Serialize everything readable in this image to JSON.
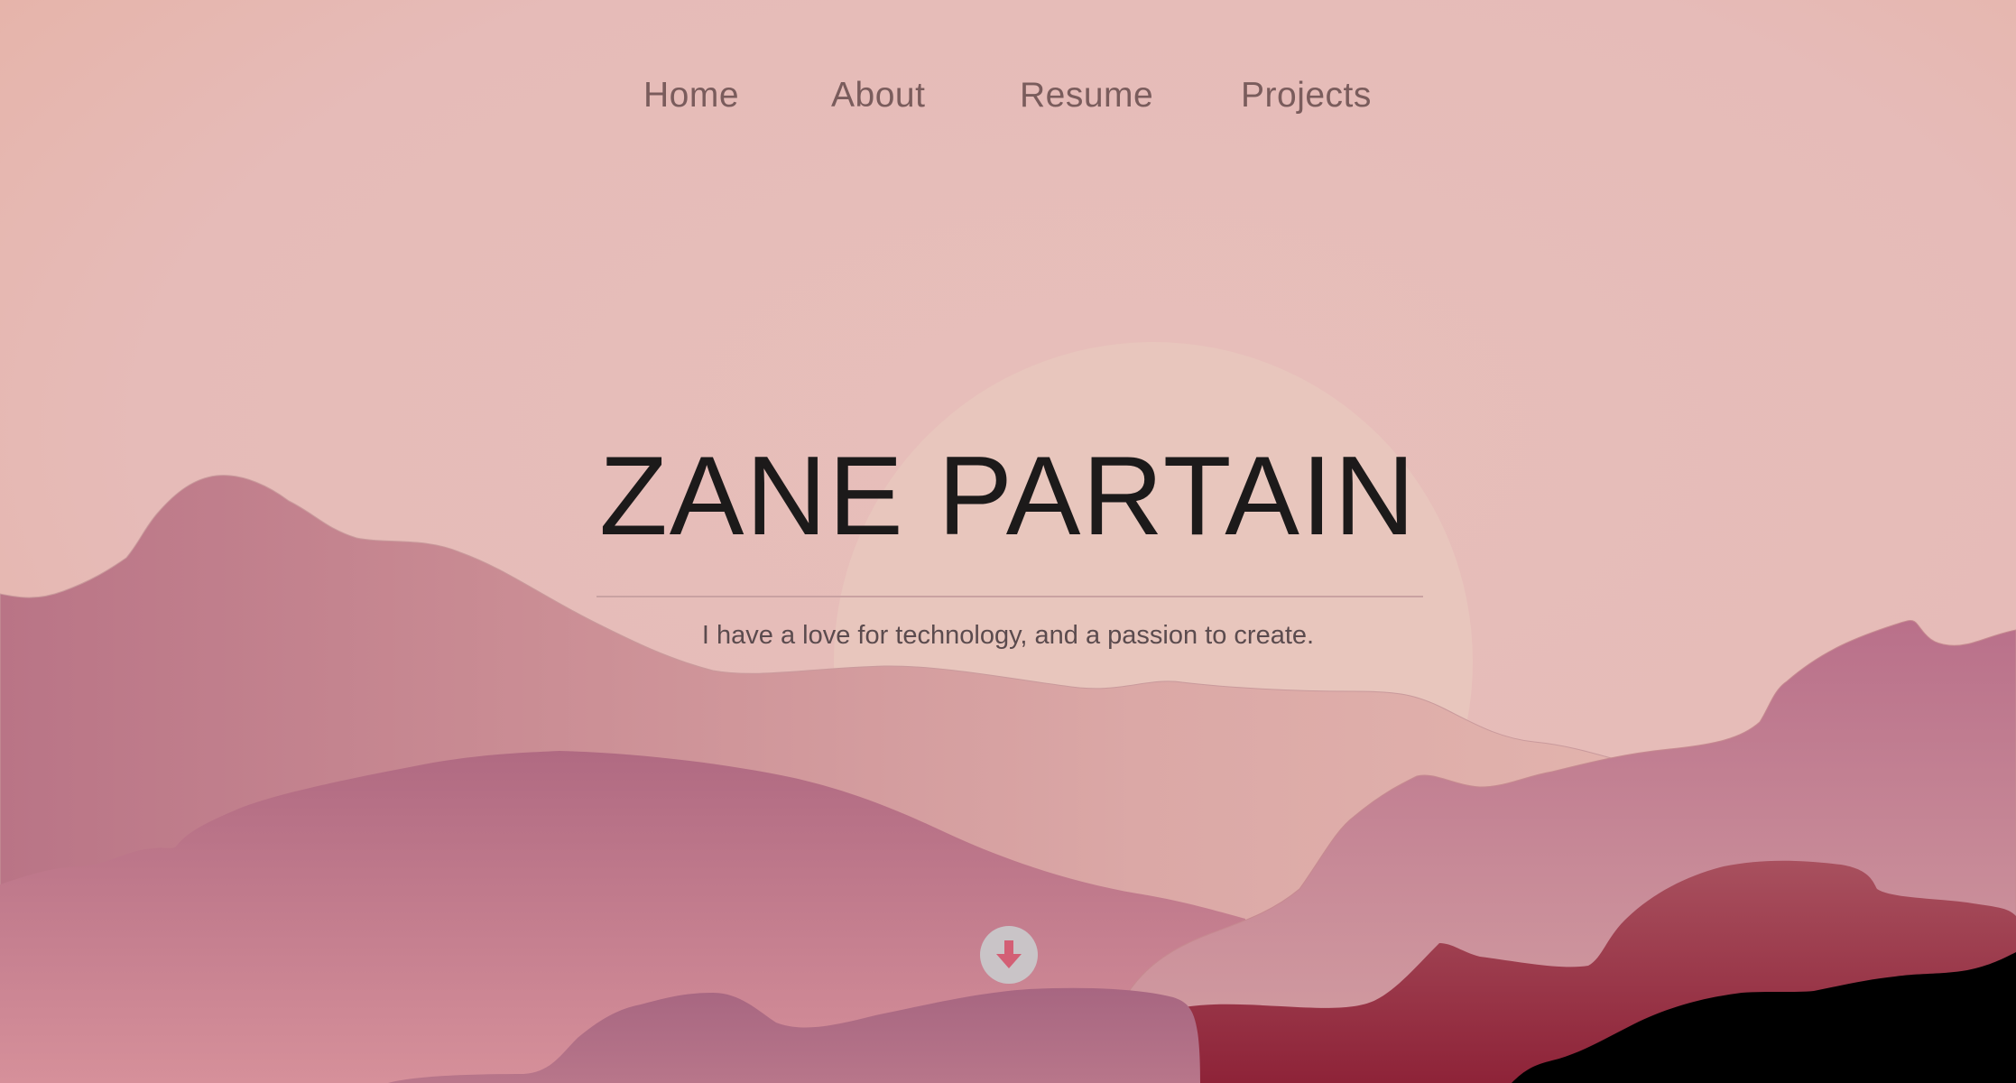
{
  "nav": {
    "items": [
      {
        "label": "Home"
      },
      {
        "label": "About"
      },
      {
        "label": "Resume"
      },
      {
        "label": "Projects"
      }
    ]
  },
  "hero": {
    "title": "ZANE PARTAIN",
    "tagline": "I have a love for technology, and a passion to create."
  },
  "scroll_button": {
    "icon": "arrow-down-icon"
  },
  "colors": {
    "sky": "#e6bcb8",
    "sun": "#e8c6bd",
    "mountain_far": "#c9868f",
    "mountain_mid": "#b4687f",
    "mountain_near": "#9a2f42",
    "foreground": "#000000",
    "title": "#1c1a1a",
    "nav_text": "#7a5c5c"
  }
}
